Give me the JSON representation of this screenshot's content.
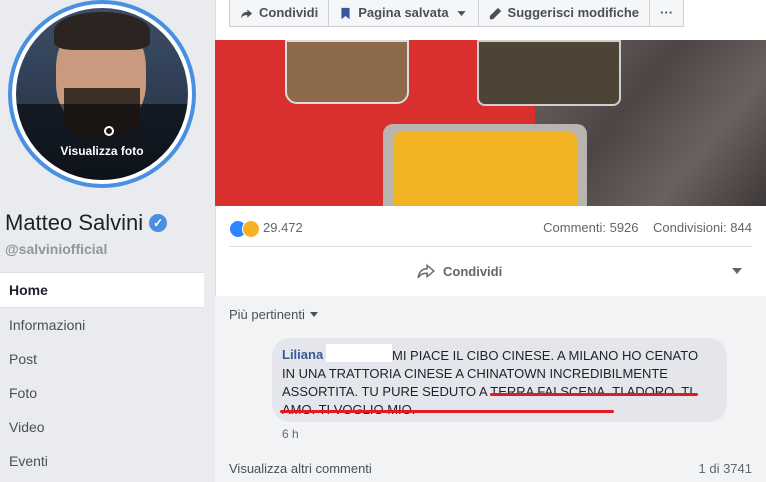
{
  "page": {
    "name": "Matteo Salvini",
    "handle": "@salviniofficial",
    "avatar_label": "Visualizza foto"
  },
  "nav": {
    "items": [
      {
        "label": "Home"
      },
      {
        "label": "Informazioni"
      },
      {
        "label": "Post"
      },
      {
        "label": "Foto"
      },
      {
        "label": "Video"
      },
      {
        "label": "Eventi"
      }
    ]
  },
  "toolbar": {
    "share_label": "Condividi",
    "saved_label": "Pagina salvata",
    "suggest_label": "Suggerisci modifiche",
    "more_label": "···"
  },
  "post": {
    "reactions_count": "29.472",
    "comments_count": "Commenti: 5926",
    "shares_count": "Condivisioni: 844",
    "share_button": "Condividi"
  },
  "comments": {
    "sort_label": "Più pertinenti",
    "items": [
      {
        "author": "Liliana",
        "text": "MI PIACE IL CIBO CINESE. A MILANO HO CENATO IN UNA TRATTORIA CINESE A CHINATOWN INCREDIBILMENTE ASSORTITA. TU PURE SEDUTO A TERRA FAI SCENA. TI ADORO. TI AMO. TI VOGLIO MIO.",
        "time": "6 h"
      }
    ],
    "more_label": "Visualizza altri commenti",
    "pager": "1 di 3741"
  },
  "colors": {
    "accent": "#4a90e2",
    "link": "#385898",
    "highlight_underline": "#e01b22"
  }
}
